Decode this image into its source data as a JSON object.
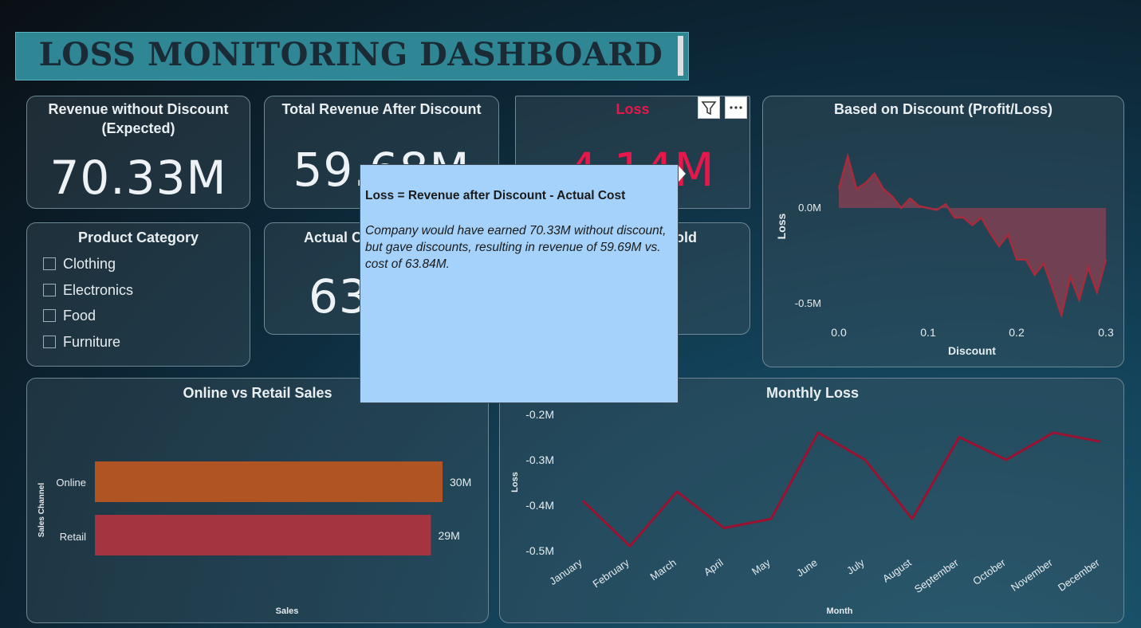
{
  "banner": {
    "title": "LOSS MONITORING DASHBOARD"
  },
  "kpis": {
    "revenue_expected": {
      "title_line1": "Revenue without Discount",
      "title_line2": "(Expected)",
      "value": "70.33M"
    },
    "revenue_after": {
      "title": "Total Revenue After Discount",
      "value": "59.68M"
    },
    "loss": {
      "title": "Loss",
      "value": "-4.14M"
    },
    "actual_cost": {
      "title": "Actual C",
      "value": "63"
    },
    "sold": {
      "title": "old"
    }
  },
  "colors": {
    "loss_red": "#e8174b",
    "online_bar": "#b05424",
    "retail_bar": "#a33440",
    "line_red": "#9a1230",
    "tooltip_bg": "#a5d2fb"
  },
  "slicer": {
    "title": "Product Category",
    "items": [
      "Clothing",
      "Electronics",
      "Food",
      "Furniture"
    ]
  },
  "tooltip": {
    "line1": "Loss = Revenue after Discount - Actual Cost",
    "line2": "Company would have earned 70.33M without discount, but gave discounts, resulting in revenue of 59.69M vs. cost of 63.84M."
  },
  "visual_header": {
    "icons": [
      "filter-icon",
      "more-options-icon"
    ]
  },
  "charts": {
    "discount": {
      "title": "Based on Discount (Profit/Loss)",
      "ylabel": "Loss",
      "xlabel": "Discount",
      "yticks": [
        "0.0M",
        "-0.5M"
      ],
      "xticks": [
        "0.0",
        "0.1",
        "0.2",
        "0.3"
      ]
    },
    "channel": {
      "title": "Online vs Retail Sales",
      "ylabel": "Sales Channel",
      "xlabel": "Sales",
      "labels": [
        "Online",
        "Retail"
      ],
      "value_labels": [
        "30M",
        "29M"
      ]
    },
    "monthly": {
      "title": "Monthly Loss",
      "ylabel": "Loss",
      "xlabel": "Month",
      "yticks": [
        "-0.2M",
        "-0.3M",
        "-0.4M",
        "-0.5M"
      ],
      "months": [
        "January",
        "February",
        "March",
        "April",
        "May",
        "June",
        "July",
        "August",
        "September",
        "October",
        "November",
        "December"
      ]
    }
  },
  "chart_data": [
    {
      "type": "area",
      "title": "Based on Discount (Profit/Loss)",
      "xlabel": "Discount",
      "ylabel": "Loss",
      "xlim": [
        0,
        0.3
      ],
      "x": [
        0.0,
        0.01,
        0.02,
        0.03,
        0.04,
        0.05,
        0.06,
        0.07,
        0.08,
        0.09,
        0.1,
        0.11,
        0.12,
        0.13,
        0.14,
        0.15,
        0.16,
        0.17,
        0.18,
        0.19,
        0.2,
        0.21,
        0.22,
        0.23,
        0.24,
        0.25,
        0.26,
        0.27,
        0.28,
        0.29,
        0.3
      ],
      "y": [
        0.1,
        0.27,
        0.1,
        0.13,
        0.18,
        0.1,
        0.06,
        0.0,
        0.05,
        0.01,
        0.0,
        -0.01,
        0.02,
        -0.05,
        -0.05,
        -0.09,
        -0.05,
        -0.13,
        -0.2,
        -0.14,
        -0.27,
        -0.27,
        -0.35,
        -0.29,
        -0.42,
        -0.56,
        -0.36,
        -0.48,
        -0.31,
        -0.44,
        -0.27
      ]
    },
    {
      "type": "bar",
      "orientation": "horizontal",
      "title": "Online vs Retail Sales",
      "xlabel": "Sales",
      "ylabel": "Sales Channel",
      "categories": [
        "Online",
        "Retail"
      ],
      "values": [
        30,
        29
      ],
      "unit": "M"
    },
    {
      "type": "line",
      "title": "Monthly Loss",
      "xlabel": "Month",
      "ylabel": "Loss",
      "ylim": [
        -0.5,
        -0.2
      ],
      "categories": [
        "January",
        "February",
        "March",
        "April",
        "May",
        "June",
        "July",
        "August",
        "September",
        "October",
        "November",
        "December"
      ],
      "values": [
        -0.39,
        -0.49,
        -0.37,
        -0.45,
        -0.43,
        -0.24,
        -0.3,
        -0.43,
        -0.25,
        -0.3,
        -0.24,
        -0.26
      ]
    }
  ]
}
